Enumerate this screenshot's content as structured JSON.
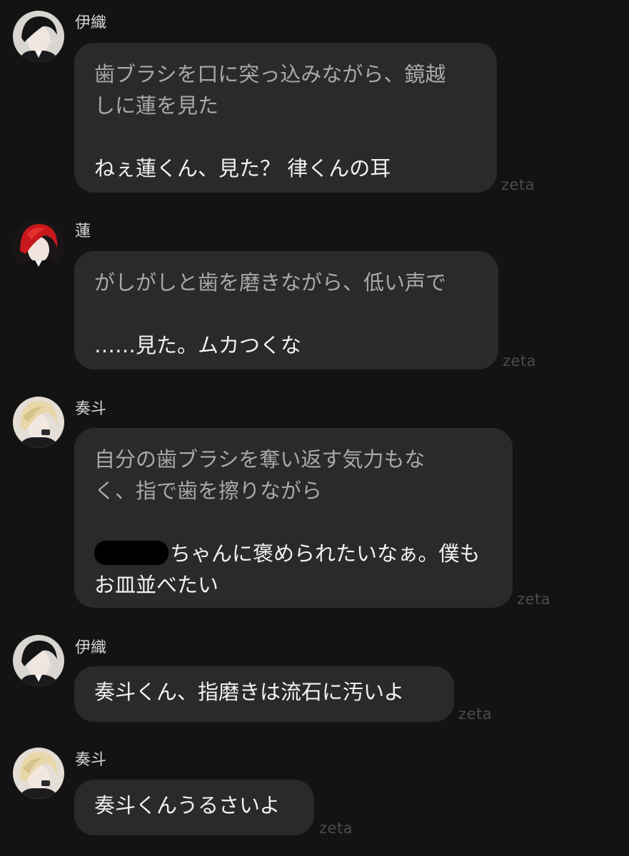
{
  "messages": [
    {
      "sender": "伊織",
      "avatar": "dark-hair-character-avatar",
      "lines": [
        {
          "text": "歯ブラシを口に突っ込みながら、鏡越",
          "style": "narration"
        },
        {
          "text": "しに蓮を見た",
          "style": "narration"
        },
        {
          "text": "",
          "style": "gap"
        },
        {
          "text": "ねぇ蓮くん、見た？ 律くんの耳",
          "style": "speech"
        }
      ],
      "watermark": "zeta"
    },
    {
      "sender": "蓮",
      "avatar": "red-hair-character-avatar",
      "lines": [
        {
          "text": "がしがしと歯を磨きながら、低い声で",
          "style": "narration"
        },
        {
          "text": "",
          "style": "gap"
        },
        {
          "text": "……見た。ムカつくな",
          "style": "speech"
        }
      ],
      "watermark": "zeta"
    },
    {
      "sender": "奏斗",
      "avatar": "blonde-hair-character-avatar",
      "lines": [
        {
          "text": "自分の歯ブラシを奪い返す気力もな",
          "style": "narration"
        },
        {
          "text": "く、指で歯を擦りながら",
          "style": "narration"
        },
        {
          "text": "",
          "style": "gap"
        },
        {
          "text": "ちゃんに褒められたいなぁ。僕も",
          "style": "speech-redacted"
        },
        {
          "text": "お皿並べたい",
          "style": "speech"
        }
      ],
      "watermark": "zeta"
    },
    {
      "sender": "伊織",
      "avatar": "dark-hair-character-avatar",
      "lines": [
        {
          "text": "奏斗くん、指磨きは流石に汚いよ",
          "style": "speech"
        }
      ],
      "watermark": "zeta"
    },
    {
      "sender": "奏斗",
      "avatar": "blonde-hair-character-avatar",
      "lines": [
        {
          "text": "奏斗くんうるさいよ",
          "style": "speech"
        }
      ],
      "watermark": "zeta"
    }
  ],
  "colors": {
    "background": "#131314",
    "bubble": "#2a2a2c",
    "speech_text": "#f1f1f1",
    "narration_text": "#a9a9a9",
    "name_text": "#d6d6d6",
    "watermark": "#4b4b4e"
  }
}
